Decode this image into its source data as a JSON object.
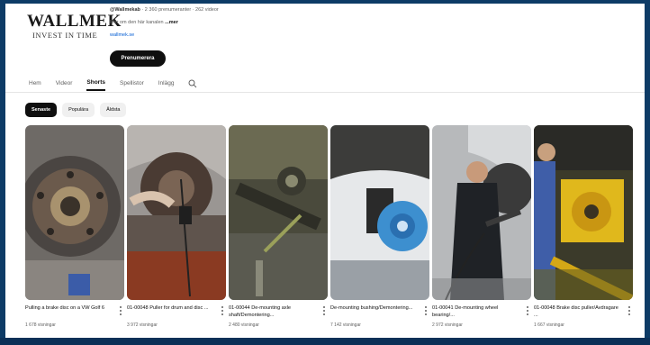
{
  "brand": {
    "name": "WALLMEK",
    "tagline": "INVEST IN TIME"
  },
  "channel": {
    "handle": "@Wallmekab",
    "stats": "· 2 360 prenumeranter · 262 videor",
    "description_prefix": "Mer om den här kanalen",
    "description_more": "...mer",
    "link": "wallmek.se",
    "subscribe_label": "Prenumerera"
  },
  "tabs": [
    "Hem",
    "Videor",
    "Shorts",
    "Spellistor",
    "Inlägg"
  ],
  "active_tab": "Shorts",
  "chips": [
    "Senaste",
    "Populära",
    "Äldsta"
  ],
  "active_chip": "Senaste",
  "shorts": [
    {
      "title": "Pulling a brake disc on a VW Golf 6",
      "views": "1 678 visningar",
      "thumb": "brake-disc-hub"
    },
    {
      "title": "01-00048 Puller for drum and disc ...",
      "views": "3 972 visningar",
      "thumb": "puller-wheel-arch"
    },
    {
      "title": "01-00044 De-mounting axle shaft/Demontering...",
      "views": "2 480 visningar",
      "thumb": "axle-shaft"
    },
    {
      "title": "De-mounting bushing/Demontering...",
      "views": "7 142 visningar",
      "thumb": "blue-bushing"
    },
    {
      "title": "01-00041 De-mounting wheel bearing/...",
      "views": "2 972 visningar",
      "thumb": "mechanic-bearing"
    },
    {
      "title": "01-00048 Brake disc puller/Avdragare ...",
      "views": "1 667 visningar",
      "thumb": "yellow-puller"
    }
  ],
  "colors": {
    "background_frame": "#0d3b66",
    "chip_active": "#0f0f0f",
    "link": "#065fd4"
  }
}
